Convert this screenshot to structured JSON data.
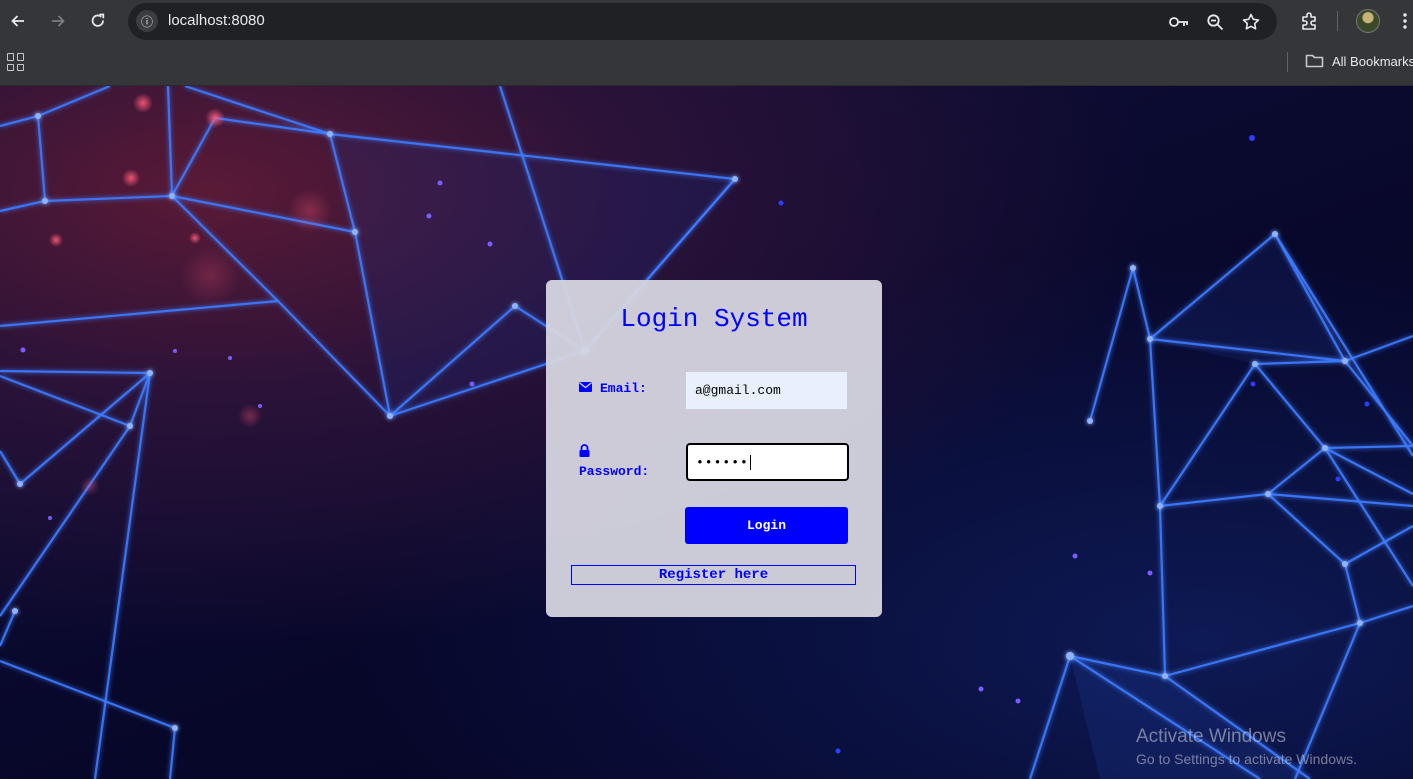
{
  "browser": {
    "url": "localhost:8080",
    "bookmarks_label": "All Bookmarks"
  },
  "login": {
    "title": "Login System",
    "email_label": "Email:",
    "email_value": "a@gmail.com",
    "password_label": "Password:",
    "password_masked": "••••••",
    "login_button": "Login",
    "register_link": "Register here"
  },
  "watermark": {
    "line1": "Activate Windows",
    "line2": "Go to Settings to activate Windows."
  },
  "colors": {
    "accent": "#0000ff",
    "chrome": "#35363a",
    "card": "#d6d6e0"
  }
}
